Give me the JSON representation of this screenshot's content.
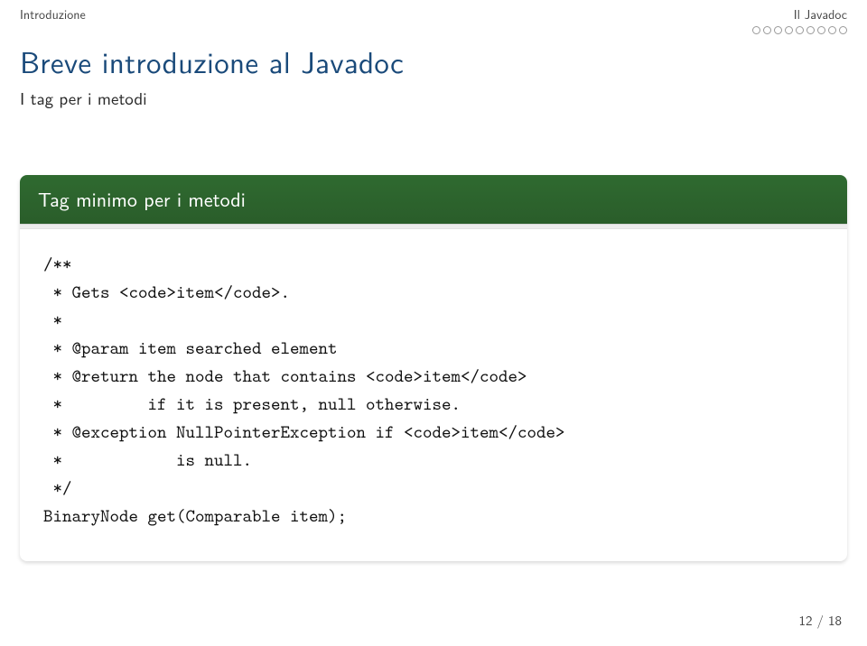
{
  "header": {
    "left_label": "Introduzione",
    "right_label": "Il Javadoc"
  },
  "progress": {
    "total": 9,
    "filled_index": -1
  },
  "title": "Breve introduzione al Javadoc",
  "subtitle": "I tag per i metodi",
  "card": {
    "heading": "Tag minimo per i metodi",
    "code_lines": [
      "/**",
      " * Gets <code>item</code>.",
      " *",
      " * @param item searched element",
      " * @return the node that contains <code>item</code>",
      " *         if it is present, null otherwise.",
      " * @exception NullPointerException if <code>item</code>",
      " *            is null.",
      " */",
      "BinaryNode get(Comparable item);"
    ]
  },
  "page": {
    "current": 12,
    "total": 18,
    "display": "12 / 18"
  }
}
